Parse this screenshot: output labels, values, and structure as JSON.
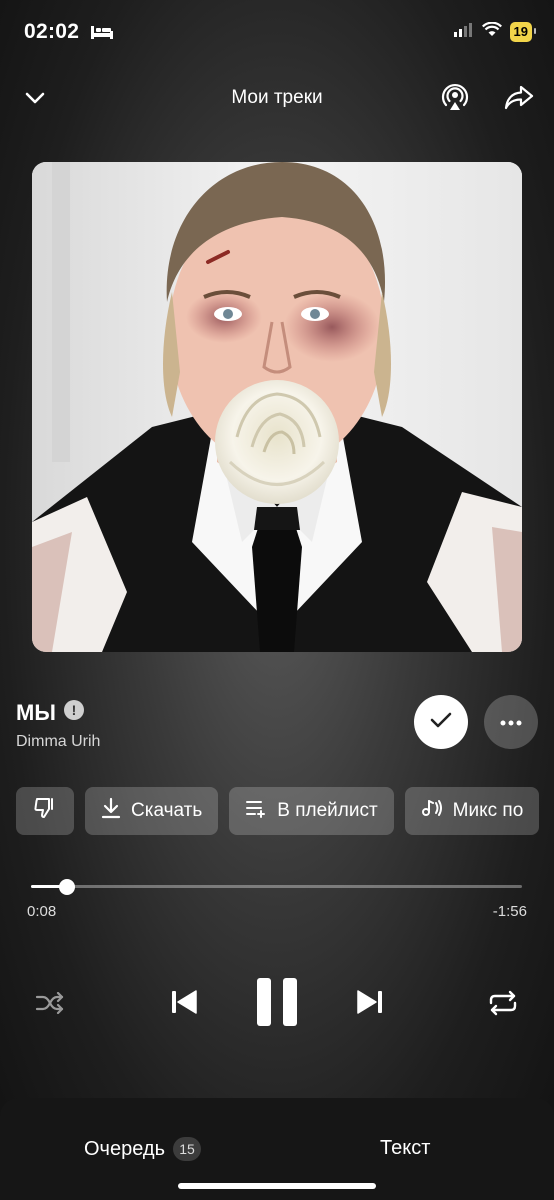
{
  "status_bar": {
    "time": "02:02",
    "battery": "19"
  },
  "header": {
    "title": "Мои треки"
  },
  "track": {
    "title": "МЫ",
    "artist": "Dimma Urih",
    "explicit_mark": "!"
  },
  "actions": {
    "download_label": "Скачать",
    "playlist_label": "В плейлист",
    "mix_label": "Микс по"
  },
  "progress": {
    "elapsed": "0:08",
    "remaining": "-1:56",
    "fraction": 0.07
  },
  "bottom_tabs": {
    "queue_label": "Очередь",
    "queue_count": "15",
    "lyrics_label": "Текст"
  },
  "icons": [
    "bed-icon",
    "signal-icon",
    "wifi-icon",
    "chevron-down-icon",
    "airplay-icon",
    "share-icon",
    "checkmark-icon",
    "more-icon",
    "dislike-icon",
    "download-icon",
    "playlist-add-icon",
    "mix-icon",
    "shuffle-icon",
    "previous-icon",
    "pause-icon",
    "next-icon",
    "repeat-icon"
  ],
  "colors": {
    "battery": "#f2d54a",
    "accent": "#ffffff"
  }
}
